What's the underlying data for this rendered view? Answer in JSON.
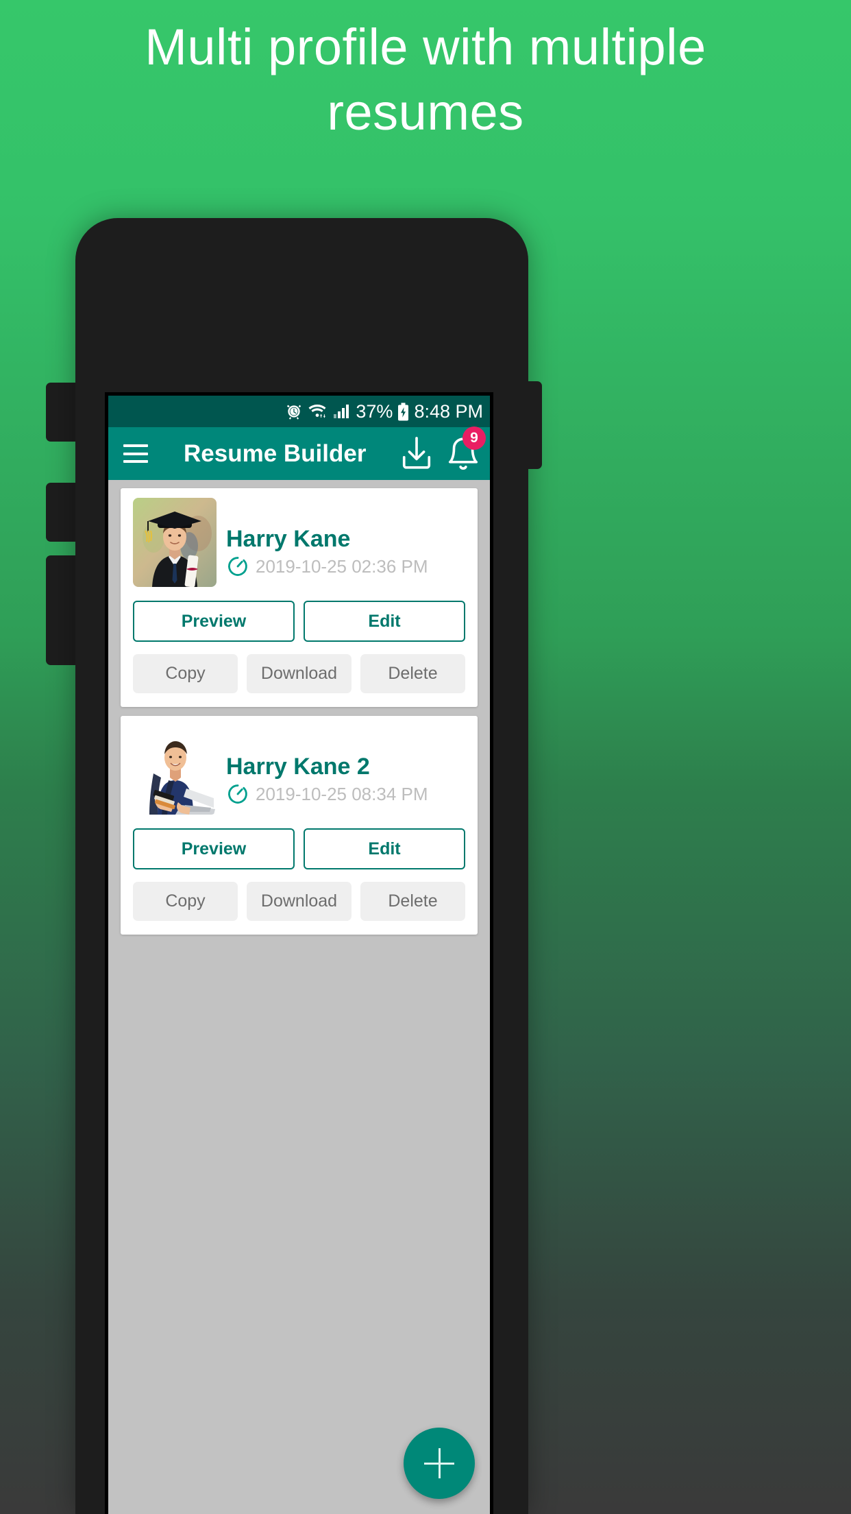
{
  "promo": {
    "headline": "Multi profile with multiple\nresumes",
    "bg_top_color": "#36c76a",
    "bg_bottom_color": "#3a3a3a"
  },
  "statusbar": {
    "battery_percent": "37%",
    "time": "8:48 PM",
    "icons": [
      "alarm-icon",
      "wifi-icon",
      "cellular-signal-icon",
      "battery-charging-icon"
    ],
    "background_color": "#00564f"
  },
  "appbar": {
    "title": "Resume Builder",
    "menu_icon": "hamburger-menu-icon",
    "download_icon": "download-icon",
    "notification_icon": "bell-icon",
    "notification_badge": "9",
    "background_color": "#00877a",
    "badge_color": "#e91e63"
  },
  "buttons": {
    "preview": "Preview",
    "edit": "Edit",
    "copy": "Copy",
    "download": "Download",
    "delete": "Delete"
  },
  "resumes": [
    {
      "name": "Harry Kane",
      "date": "2019-10-25 02:36 PM",
      "avatar": "graduate-photo",
      "clock_icon": "timer-icon"
    },
    {
      "name": "Harry Kane 2",
      "date": "2019-10-25 08:34 PM",
      "avatar": "student-with-laptop-photo",
      "clock_icon": "timer-icon"
    }
  ],
  "fab": {
    "icon": "plus-icon",
    "color": "#008878"
  },
  "theme": {
    "accent": "#00786c",
    "list_background": "#c2c2c2",
    "card_background": "#ffffff",
    "flat_button_background": "#efefef"
  }
}
